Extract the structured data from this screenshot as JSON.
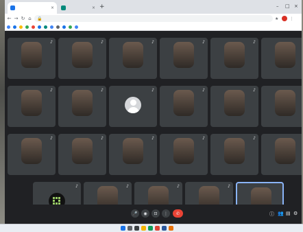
{
  "colors": {
    "meeting_bg": "#202124",
    "tile_bg": "#3c4043",
    "self_border": "#8ab4f8",
    "end_call": "#ea4335"
  },
  "browser": {
    "tabs": [
      {
        "title": "",
        "fav_color": "#1a73e8",
        "close": "×"
      },
      {
        "title": "",
        "fav_color": "#00897b",
        "close": "×"
      }
    ],
    "new_tab": "+",
    "window_controls": [
      "–",
      "□",
      "×"
    ],
    "nav": {
      "back": "←",
      "forward": "→",
      "reload": "↻",
      "home": "⌂"
    },
    "address": "",
    "lock": "🔒",
    "extensions": [
      "★",
      "⋮"
    ],
    "bookmarks": [
      {
        "label": "",
        "color": "#4285f4"
      },
      {
        "label": "",
        "color": "#1a73e8"
      },
      {
        "label": "",
        "color": "#fbbc04"
      },
      {
        "label": "",
        "color": "#34a853"
      },
      {
        "label": "",
        "color": "#ea4335"
      },
      {
        "label": "",
        "color": "#1a73e8"
      },
      {
        "label": "",
        "color": "#00897b"
      },
      {
        "label": "",
        "color": "#4285f4"
      },
      {
        "label": "",
        "color": "#5f6368"
      },
      {
        "label": "",
        "color": "#1a73e8"
      },
      {
        "label": "",
        "color": "#34a853"
      },
      {
        "label": "",
        "color": "#4285f4"
      }
    ]
  },
  "meeting": {
    "participants": [
      {
        "name": "",
        "kind": "video",
        "mic": "♪"
      },
      {
        "name": "",
        "kind": "video",
        "mic": "♪"
      },
      {
        "name": "",
        "kind": "video",
        "mic": "♪"
      },
      {
        "name": "",
        "kind": "video",
        "mic": "♪"
      },
      {
        "name": "",
        "kind": "video",
        "mic": "♪"
      },
      {
        "name": "",
        "kind": "video",
        "mic": "♪"
      },
      {
        "name": "",
        "kind": "video",
        "mic": "♪"
      },
      {
        "name": "",
        "kind": "video",
        "mic": "♪"
      },
      {
        "name": "",
        "kind": "avatar-grey",
        "mic": "♪"
      },
      {
        "name": "",
        "kind": "video",
        "mic": "♪"
      },
      {
        "name": "",
        "kind": "video",
        "mic": "♪"
      },
      {
        "name": "",
        "kind": "video",
        "mic": "♪"
      },
      {
        "name": "",
        "kind": "video",
        "mic": "♪"
      },
      {
        "name": "",
        "kind": "video",
        "mic": "♪"
      },
      {
        "name": "",
        "kind": "video",
        "mic": "♪"
      },
      {
        "name": "",
        "kind": "video",
        "mic": "♪"
      },
      {
        "name": "",
        "kind": "video",
        "mic": "♪"
      },
      {
        "name": "",
        "kind": "video",
        "mic": "♪"
      },
      {
        "name": "",
        "kind": "avatar-dark",
        "mic": "♪"
      },
      {
        "name": "",
        "kind": "video",
        "mic": "♪"
      },
      {
        "name": "",
        "kind": "video",
        "mic": "♪"
      },
      {
        "name": "",
        "kind": "video",
        "mic": "♪"
      },
      {
        "name": "",
        "kind": "video",
        "mic": "♪"
      },
      {
        "name": "",
        "kind": "video",
        "mic": "♪"
      },
      {
        "name": "",
        "kind": "avatar-purple",
        "mic": "♪"
      },
      {
        "name": "",
        "kind": "video",
        "mic": "♪"
      },
      {
        "name": "",
        "kind": "self",
        "mic": ""
      }
    ],
    "code": "",
    "controls": [
      {
        "name": "mic-toggle-button",
        "glyph": "🎤"
      },
      {
        "name": "camera-toggle-button",
        "glyph": "◉"
      },
      {
        "name": "present-button",
        "glyph": "⊡"
      },
      {
        "name": "more-options-button",
        "glyph": "⋮"
      },
      {
        "name": "end-call-button",
        "glyph": "✆"
      }
    ],
    "right_icons": [
      {
        "name": "info-icon",
        "glyph": "ⓘ"
      },
      {
        "name": "people-icon",
        "glyph": "👥"
      },
      {
        "name": "chat-icon",
        "glyph": "▤"
      },
      {
        "name": "activities-icon",
        "glyph": "⚙"
      }
    ],
    "participant_count": ""
  },
  "taskbar": {
    "apps": [
      {
        "name": "start-icon",
        "color": "#1a73e8"
      },
      {
        "name": "search-icon",
        "color": "#5f6368"
      },
      {
        "name": "taskview-icon",
        "color": "#3c4043"
      },
      {
        "name": "explorer-icon",
        "color": "#f4b400"
      },
      {
        "name": "edge-icon",
        "color": "#0f9d58"
      },
      {
        "name": "chrome-icon",
        "color": "#db4437"
      },
      {
        "name": "word-icon",
        "color": "#2b579a"
      },
      {
        "name": "app-icon",
        "color": "#e8710a"
      }
    ],
    "tray": ""
  }
}
